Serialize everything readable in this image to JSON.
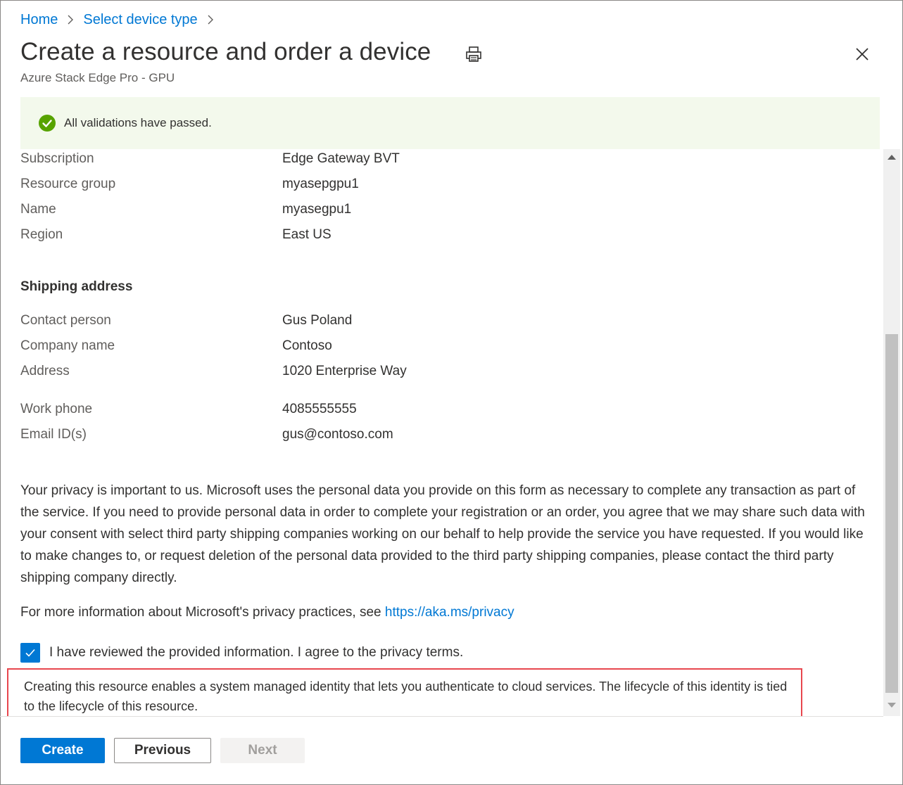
{
  "breadcrumb": {
    "home": "Home",
    "select_device_type": "Select device type"
  },
  "header": {
    "title": "Create a resource and order a device",
    "subtitle": "Azure Stack Edge Pro - GPU"
  },
  "banner": {
    "message": "All validations have passed."
  },
  "basics": [
    {
      "label": "Subscription",
      "value": "Edge Gateway BVT"
    },
    {
      "label": "Resource group",
      "value": "myasepgpu1"
    },
    {
      "label": "Name",
      "value": "myasegpu1"
    },
    {
      "label": "Region",
      "value": "East US"
    }
  ],
  "shipping": {
    "title": "Shipping address",
    "fields": [
      {
        "label": "Contact person",
        "value": "Gus Poland"
      },
      {
        "label": "Company name",
        "value": "Contoso"
      },
      {
        "label": "Address",
        "value": "1020 Enterprise Way"
      },
      {
        "label": "Work phone",
        "value": "4085555555"
      },
      {
        "label": "Email ID(s)",
        "value": "gus@contoso.com"
      }
    ]
  },
  "privacy": {
    "text": "Your privacy is important to us. Microsoft uses the personal data you provide on this form as necessary to complete any transaction as part of the service. If you need to provide personal data in order to complete your registration or an order, you agree that we may share such data with your consent with select third party shipping companies working on our behalf to help provide the service you have requested. If you would like to make changes to, or request deletion of the personal data provided to the third party shipping companies, please contact the third party shipping company directly.",
    "more_prefix": "For more information about Microsoft's privacy practices, see ",
    "link": "https://aka.ms/privacy",
    "agree_label": "I have reviewed the provided information. I agree to the privacy terms.",
    "agree_checked": true
  },
  "callout": {
    "text": "Creating this resource enables a system managed identity that lets you authenticate to cloud services. The lifecycle of this identity is tied to the lifecycle of this resource."
  },
  "footer": {
    "create": "Create",
    "previous": "Previous",
    "next": "Next"
  },
  "colors": {
    "accent": "#0078d4",
    "success": "#57a300",
    "callout_border": "#e8474e",
    "banner_bg": "#f3f9ec"
  },
  "icons": {
    "print": "print-icon",
    "close": "close-icon",
    "success": "success-check-icon",
    "checkbox": "checkmark-icon"
  }
}
